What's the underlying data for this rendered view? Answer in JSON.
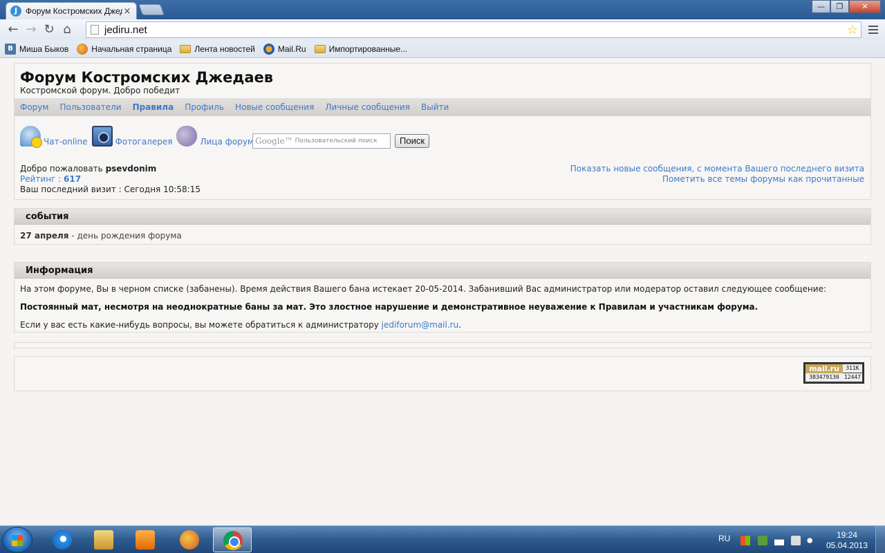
{
  "browser": {
    "tab_title": "Форум Костромских Джедаев",
    "tab_favicon": "J",
    "tab_close": "×",
    "url": "jediru.net",
    "window_buttons": {
      "minimize": "—",
      "maximize": "❐",
      "close": "✕"
    },
    "nav": {
      "back": "←",
      "forward": "→",
      "reload": "↻",
      "home": "⌂",
      "star": "☆"
    },
    "bookmarks": [
      {
        "label": "Миша Быков",
        "icon": "vk-icon"
      },
      {
        "label": "Начальная страница",
        "icon": "firefox-icon"
      },
      {
        "label": "Лента новостей",
        "icon": "folder-icon"
      },
      {
        "label": "Mail.Ru",
        "icon": "mailru-icon"
      },
      {
        "label": "Импортированные...",
        "icon": "folder-icon"
      }
    ]
  },
  "site": {
    "title": "Форум Костромских Джедаев",
    "description": "Костромской форум. Добро победит",
    "nav": {
      "forum": "Форум",
      "users": "Пользователи",
      "rules": "Правила",
      "profile": "Профиль",
      "new_messages": "Новые сообщения",
      "private_messages": "Личные сообщения",
      "logout": "Выйти"
    },
    "quicklinks": {
      "chat": "Чат-online",
      "gallery": "Фотогалерея",
      "faces": "Лица форума"
    },
    "search": {
      "google_word": "Google™",
      "placeholder": "Пользовательский поиск",
      "button": "Поиск"
    },
    "welcome": {
      "greeting": "Добро пожаловать",
      "username": "psevdonim",
      "rating_label": "Рейтинг :",
      "rating_value": "617",
      "last_visit": "Ваш последний визит : Сегодня 10:58:15"
    },
    "right_links": {
      "show_new": "Показать новые сообщения, с момента Вашего последнего визита",
      "mark_read": "Пометить все темы форумы как прочитанные"
    }
  },
  "events": {
    "title": "события",
    "date": "27 апреля",
    "text": "- день рождения форума"
  },
  "info": {
    "title": "Информация",
    "ban_text": "На этом форуме, Вы в черном списке (забанены). Время действия Вашего бана истекает 20-05-2014. Забанивший Вас администратор или модератор оставил следующее сообщение:",
    "ban_reason": "Постоянный мат, несмотря на неоднократные баны за мат. Это злостное нарушение и демонстративное неуважение к Правилам и участникам форума.",
    "contact_text": "Если у вас есть какие-нибудь вопросы, вы можете обратиться к администратору",
    "contact_email": "jediforum@mail.ru",
    "contact_end": "."
  },
  "counter": {
    "logo": "mail.ru",
    "a": "311K",
    "b": "383479130",
    "c": "12447"
  },
  "taskbar": {
    "lang": "RU",
    "time": "19:24",
    "date": "05.04.2013"
  }
}
